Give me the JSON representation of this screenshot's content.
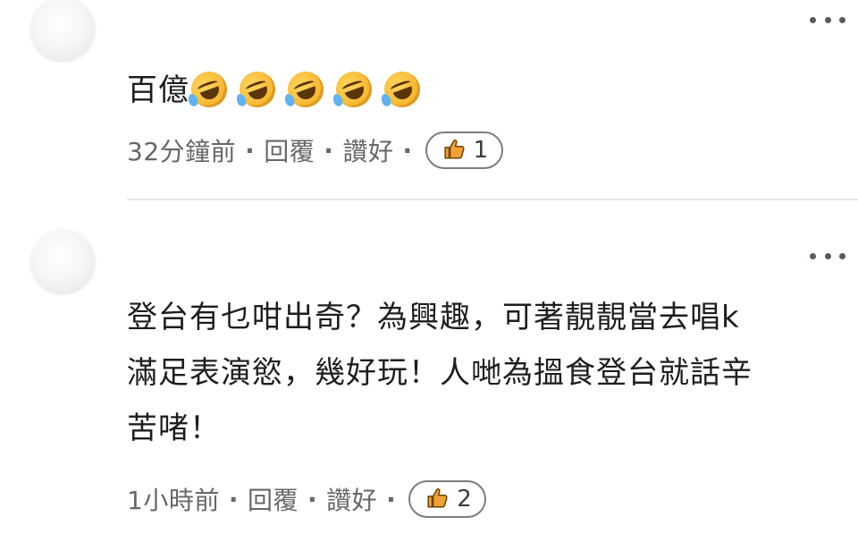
{
  "comments": [
    {
      "text": "百億",
      "emoji_name": "rolling-on-the-floor-laughing",
      "emoji_count": 5,
      "time": "32分鐘前",
      "reply_label": "回覆",
      "like_label": "讚好",
      "like_count": "1"
    },
    {
      "text": "登台有乜咁出奇？為興趣，可著靚靚當去唱k\n滿足表演慾，幾好玩！人哋為搵食登台就話辛\n苦啫！",
      "time": "1小時前",
      "reply_label": "回覆",
      "like_label": "讚好",
      "like_count": "2"
    }
  ],
  "separator": "·",
  "icons": {
    "more": "more-horizontal-icon",
    "thumb": "thumbs-up-icon"
  },
  "colors": {
    "text": "#1c1e21",
    "meta": "#65676b",
    "divider": "#e4e6eb",
    "thumb_fill": "#f0a236"
  }
}
